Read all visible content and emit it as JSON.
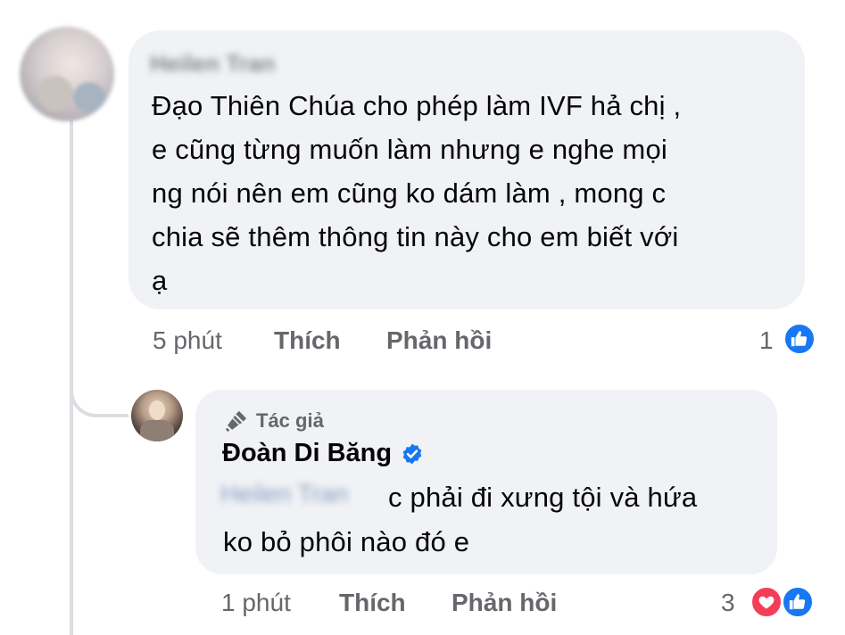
{
  "comment": {
    "author_name": "Heilen Tran",
    "lines": [
      "Đạo Thiên Chúa cho phép làm IVF hả chị ,",
      "e cũng từng muốn làm nhưng e nghe mọi",
      "ng nói nên em cũng ko dám làm , mong c",
      "chia sẽ thêm thông tin này cho em biết với",
      "ạ"
    ],
    "time": "5 phút",
    "like_label": "Thích",
    "reply_label": "Phản hồi",
    "reaction_count": "1",
    "reactions": [
      "like-icon"
    ]
  },
  "reply": {
    "badge_label": "Tác giả",
    "author_name": "Đoàn Di Băng",
    "verified": true,
    "mention": "Heilen Tran",
    "lines": [
      "c phải đi xưng tội và hứa",
      "ko bỏ phôi nào đó e"
    ],
    "time": "1 phút",
    "like_label": "Thích",
    "reply_label": "Phản hồi",
    "reaction_count": "3",
    "reactions": [
      "love-icon",
      "like-icon"
    ]
  },
  "colors": {
    "bubble_bg": "#f0f2f5",
    "meta_text": "#65676b",
    "like_blue": "#1877f2",
    "love_red": "#f33e58",
    "verified_blue": "#1877f2"
  }
}
